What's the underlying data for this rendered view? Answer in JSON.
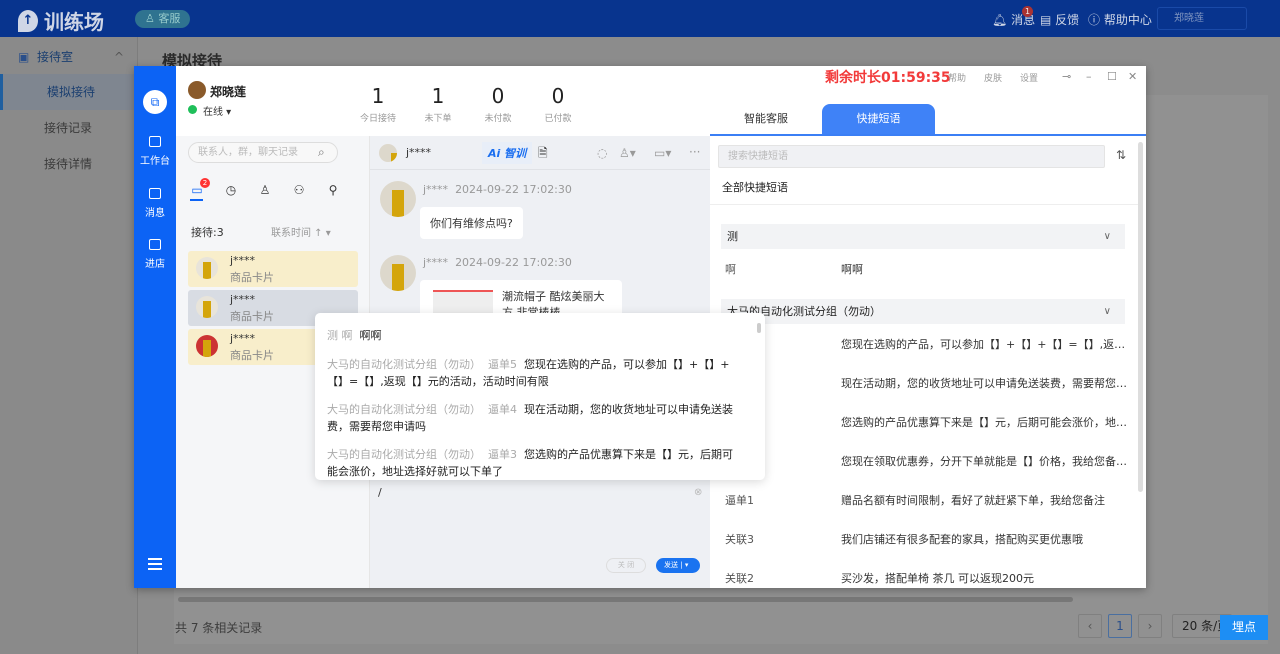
{
  "topbar": {
    "logo": "训练场",
    "role": "客服",
    "messages": "消息",
    "messages_badge": "1",
    "feedback": "反馈",
    "help_center": "帮助中心",
    "user": "郑晓莲"
  },
  "sidebar": {
    "group": "接待室",
    "items": [
      {
        "label": "模拟接待",
        "selected": true
      },
      {
        "label": "接待记录"
      },
      {
        "label": "接待详情"
      }
    ]
  },
  "page": {
    "title": "模拟接待",
    "record_count": "共 7 条相关记录",
    "current_page": "1",
    "page_size": "20 条/页",
    "maidian": "埋点"
  },
  "modal": {
    "rail": [
      {
        "label": "工作台"
      },
      {
        "label": "消息"
      },
      {
        "label": "进店"
      }
    ],
    "agent": {
      "name": "郑晓莲",
      "status": "在线"
    },
    "stats": [
      {
        "value": "1",
        "label": "今日接待"
      },
      {
        "value": "1",
        "label": "未下单"
      },
      {
        "value": "0",
        "label": "未付款"
      },
      {
        "value": "0",
        "label": "已付款"
      }
    ],
    "timer": "剩余时长01:59:35",
    "header_links": [
      "帮助",
      "皮肤",
      "设置"
    ],
    "tabs": [
      {
        "label": "智能客服"
      },
      {
        "label": "快捷短语",
        "active": true
      }
    ],
    "contacts": {
      "search_placeholder": "联系人，群，聊天记录",
      "badge": "2",
      "count": "接待:3",
      "sort": "联系时间 ↑ ▾",
      "items": [
        {
          "name": "j****",
          "sub": "商品卡片"
        },
        {
          "name": "j****",
          "sub": "商品卡片"
        },
        {
          "name": "j****",
          "sub": "商品卡片"
        }
      ]
    },
    "chat": {
      "title": "j****",
      "ai_label": "Ai 智训",
      "messages": [
        {
          "sender": "j****",
          "time": "2024-09-22 17:02:30",
          "text": "你们有维修点吗?"
        },
        {
          "sender": "j****",
          "time": "2024-09-22 17:02:30",
          "text": "潮流帽子 酷炫美丽大方 非常棒棒"
        }
      ],
      "input_value": "/",
      "close_label": "关 闭",
      "send_label": "发送 |"
    },
    "popup": {
      "items": [
        {
          "group": "测",
          "key": "啊",
          "text": "啊啊"
        },
        {
          "group": "大马的自动化测试分组（勿动）",
          "key": "逼单5",
          "text": "您现在选购的产品，可以参加【】+【】+【】=【】,返现【】元的活动，活动时间有限"
        },
        {
          "group": "大马的自动化测试分组（勿动）",
          "key": "逼单4",
          "text": "现在活动期，您的收货地址可以申请免送装费，需要帮您申请吗"
        },
        {
          "group": "大马的自动化测试分组（勿动）",
          "key": "逼单3",
          "text": "您选购的产品优惠算下来是【】元，后期可能会涨价，地址选择好就可以下单了"
        }
      ]
    },
    "quick": {
      "search_placeholder": "搜索快捷短语",
      "all_label": "全部快捷短语",
      "groups": [
        {
          "name": "测",
          "rows": [
            {
              "key": "啊",
              "text": "啊啊"
            }
          ]
        },
        {
          "name": "大马的自动化测试分组（勿动）",
          "rows": [
            {
              "key": "",
              "text": "您现在选购的产品，可以参加【】+【】+【】=【】,返现【】元的活动，活动时间有限"
            },
            {
              "key": "",
              "text": "现在活动期，您的收货地址可以申请免送装费，需要帮您申请吗"
            },
            {
              "key": "",
              "text": "您选购的产品优惠算下来是【】元，后期可能会涨价，地址选择好就可以下单了"
            },
            {
              "key": "",
              "text": "您现在领取优惠券，分开下单就能是【】价格，我给您备注赠品"
            },
            {
              "key": "逼单1",
              "text": "赠品名额有时间限制，看好了就赶紧下单，我给您备注"
            },
            {
              "key": "关联3",
              "text": "我们店铺还有很多配套的家具，搭配购买更优惠哦"
            },
            {
              "key": "关联2",
              "text": "买沙发，搭配单椅 茶几 可以返现200元"
            }
          ]
        }
      ]
    }
  },
  "colors": {
    "topbar": "#08348e",
    "rail": "#0c63f5",
    "timer": "#f23a3a",
    "tab_active": "#3f82f7",
    "send": "#1a73f0"
  }
}
